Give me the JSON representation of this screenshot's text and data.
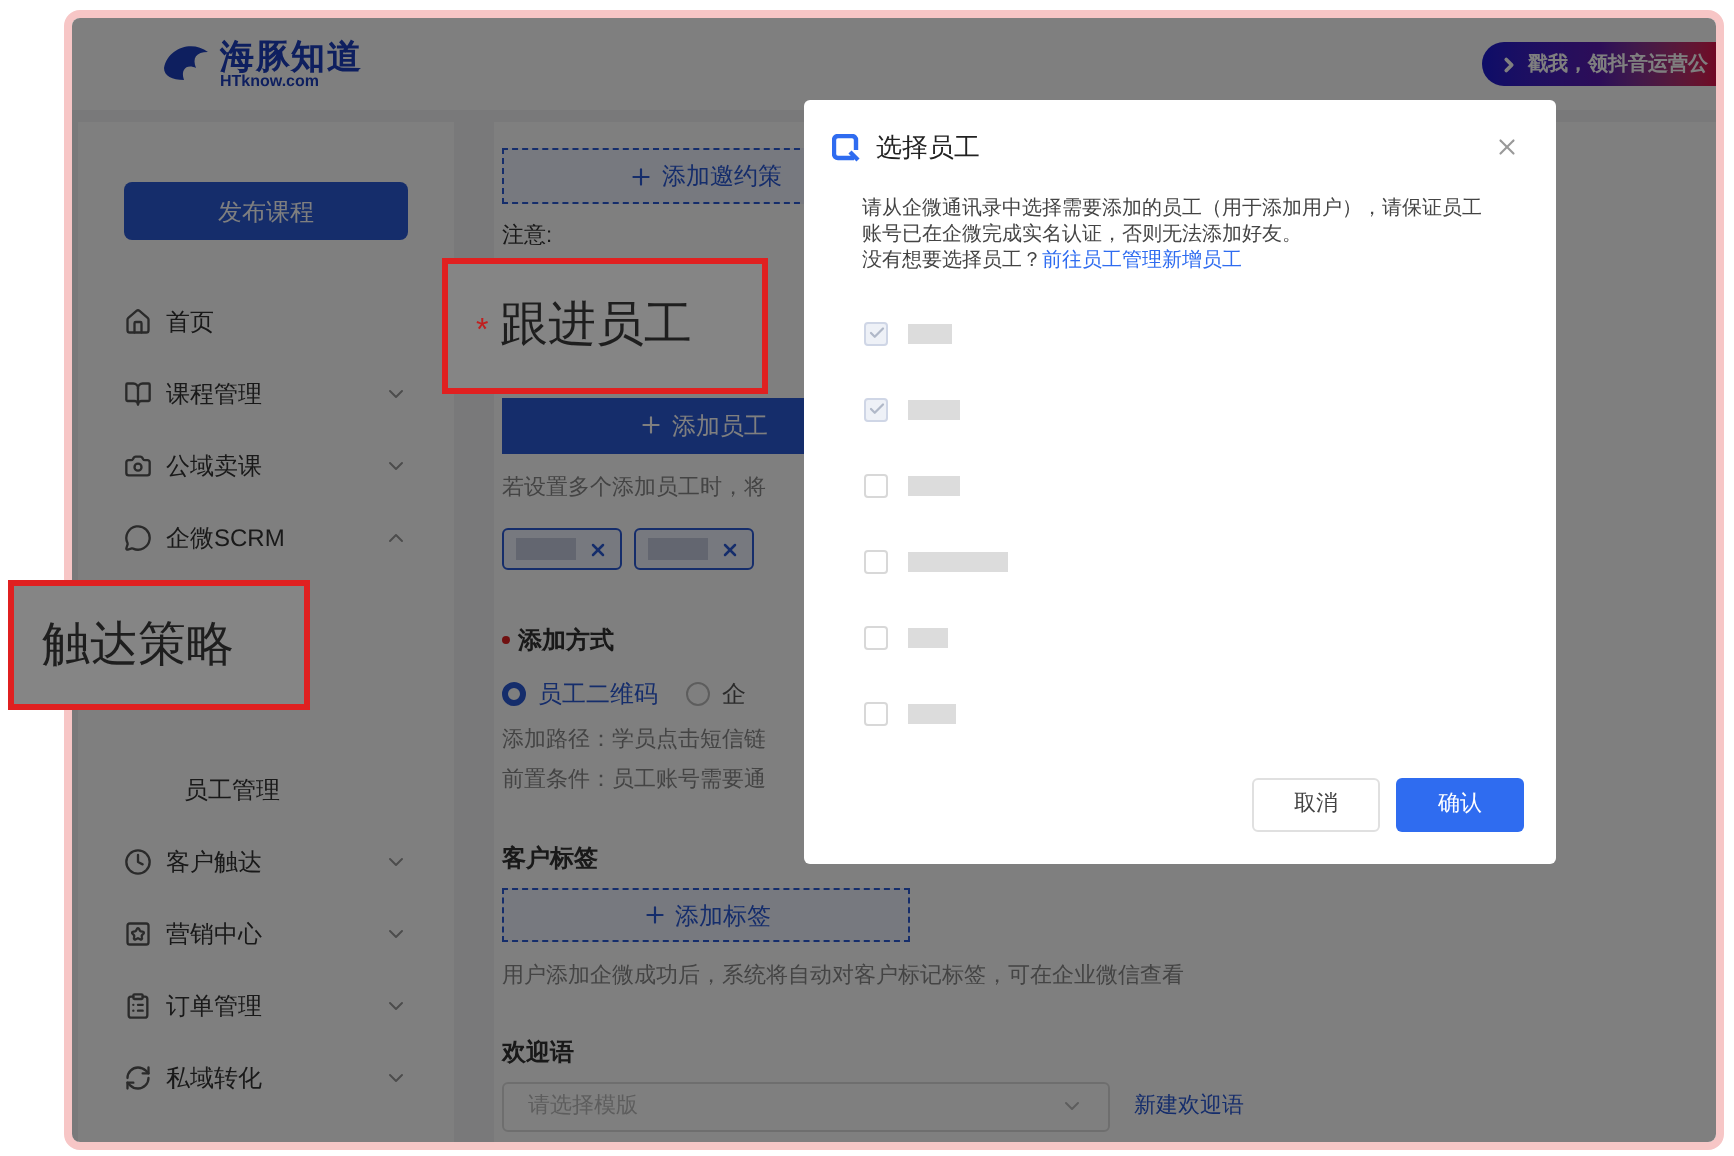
{
  "header": {
    "logo_name": "海豚知道",
    "logo_domain": "HTknow.com",
    "promo_banner": "戳我，领抖音运营公"
  },
  "sidebar": {
    "publish_button": "发布课程",
    "items": [
      {
        "label": "首页",
        "kind": "link"
      },
      {
        "label": "课程管理",
        "kind": "group",
        "expanded": false
      },
      {
        "label": "公域卖课",
        "kind": "group",
        "expanded": false
      },
      {
        "label": "企微SCRM",
        "kind": "group",
        "expanded": true,
        "children": [
          {
            "label": "员工管理"
          }
        ]
      },
      {
        "label": "客户触达",
        "kind": "group",
        "expanded": false
      },
      {
        "label": "营销中心",
        "kind": "group",
        "expanded": false
      },
      {
        "label": "订单管理",
        "kind": "group",
        "expanded": false
      },
      {
        "label": "私域转化",
        "kind": "group",
        "expanded": false
      }
    ]
  },
  "content": {
    "invite_strategy_button": "添加邀约策",
    "notice_label": "注意:",
    "add_employee_button": "添加员工",
    "employee_hint": "若设置多个添加员工时，将",
    "employee_tags": [
      {
        "removable": true
      },
      {
        "removable": true
      }
    ],
    "add_method": {
      "label": "添加方式",
      "required": true,
      "options": [
        {
          "label": "员工二维码",
          "selected": true
        },
        {
          "label": "企",
          "selected": false
        }
      ],
      "path_note": "添加路径：学员点击短信链",
      "precondition_note": "前置条件：员工账号需要通"
    },
    "customer_tags": {
      "label": "客户标签",
      "add_button": "添加标签",
      "hint": "用户添加企微成功后，系统将自动对客户标记标签，可在企业微信查看"
    },
    "welcome": {
      "label": "欢迎语",
      "placeholder": "请选择模版",
      "create_link": "新建欢迎语"
    }
  },
  "dialog": {
    "title": "选择员工",
    "description": "请从企微通讯录中选择需要添加的员工（用于添加用户），请保证员工账号已在企微完成实名认证，否则无法添加好友。",
    "prompt": "没有想要选择员工？",
    "link": "前往员工管理新增员工",
    "employees": [
      {
        "checked": true
      },
      {
        "checked": true
      },
      {
        "checked": false
      },
      {
        "checked": false
      },
      {
        "checked": false
      },
      {
        "checked": false
      }
    ],
    "buttons": [
      {
        "label": "取消",
        "kind": "secondary"
      },
      {
        "label": "确认",
        "kind": "primary"
      }
    ]
  },
  "callouts": [
    {
      "label": "跟进员工",
      "required_mark": "*"
    },
    {
      "label": "触达策略"
    }
  ]
}
